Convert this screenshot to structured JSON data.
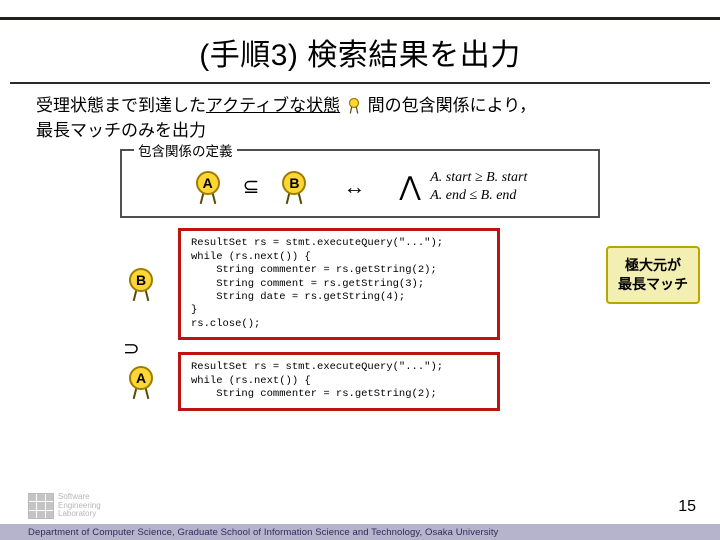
{
  "title": "(手順3) 検索結果を出力",
  "lead": {
    "part1": "受理状態まで到達した",
    "underlined": "アクティブな状態",
    "part2": "間の包含関係により，",
    "part3": "最長マッチのみを出力"
  },
  "defbox": {
    "legend": "包含関係の定義",
    "left_label": "A",
    "subset_sym": "⊆",
    "right_label": "B",
    "iff_sym": "↔",
    "and_sym": "⋀",
    "eq1": "A. start ≥ B. start",
    "eq2": "A. end ≤ B. end"
  },
  "blocks": {
    "supset_sym": "⊃",
    "B_label": "B",
    "A_label": "A",
    "code_B": "ResultSet rs = stmt.executeQuery(\"...\");\nwhile (rs.next()) {\n    String commenter = rs.getString(2);\n    String comment = rs.getString(3);\n    String date = rs.getString(4);\n}\nrs.close();",
    "code_A": "ResultSet rs = stmt.executeQuery(\"...\");\nwhile (rs.next()) {\n    String commenter = rs.getString(2);"
  },
  "callout": {
    "line1": "極大元が",
    "line2": "最長マッチ"
  },
  "footer": {
    "logo1": "Software",
    "logo2": "Engineering",
    "logo3": "Laboratory",
    "page": "15",
    "affil": "Department of Computer Science, Graduate School of Information Science and Technology, Osaka University"
  }
}
